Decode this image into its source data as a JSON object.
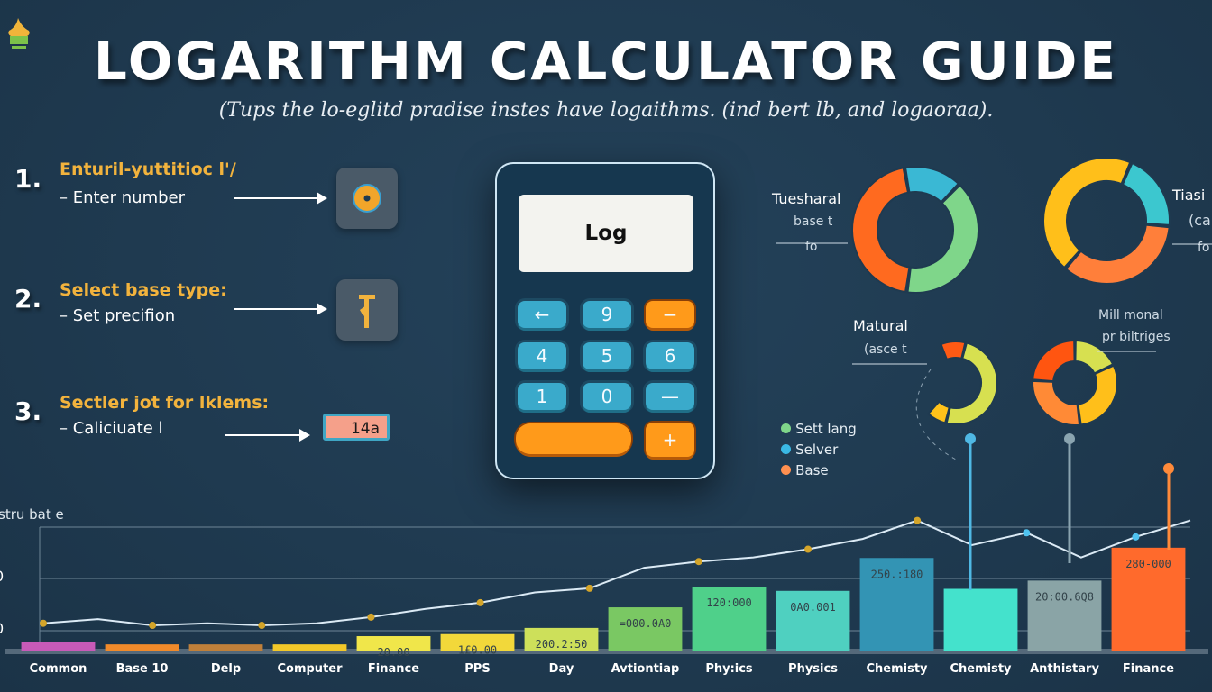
{
  "header": {
    "logo_icon": "calculator-hat-icon",
    "title": "LOGARITHM CALCULATOR GUIDE",
    "subtitle": "(Tups the lo-eglitd pradise instes have logaithms. (ind bert lb, and logaoraa)."
  },
  "steps": [
    {
      "number": "1.",
      "heading": "Enturil-yuttitioc l'/",
      "detail": "– Enter number",
      "icon": "input-dial-icon"
    },
    {
      "number": "2.",
      "heading": "Select base type:",
      "detail": "– Set precifion",
      "icon": "base-select-icon"
    },
    {
      "number": "3.",
      "heading": "Sectler jot for lklems:",
      "detail": "– Caliciuate l",
      "result_value": "14a"
    }
  ],
  "calculator": {
    "display": "Log",
    "keys": [
      {
        "label": "←",
        "color": "blue",
        "icon": "backspace-arrow-icon"
      },
      {
        "label": "9",
        "color": "blue"
      },
      {
        "label": "−",
        "color": "orange"
      },
      {
        "label": "4",
        "color": "blue"
      },
      {
        "label": "5",
        "color": "blue"
      },
      {
        "label": "6",
        "color": "blue"
      },
      {
        "label": "1",
        "color": "blue"
      },
      {
        "label": "0",
        "color": "blue"
      },
      {
        "label": "—",
        "color": "blue"
      },
      {
        "label": "",
        "color": "orange",
        "wide": true
      },
      {
        "label": "+",
        "color": "orange"
      }
    ]
  },
  "donuts": [
    {
      "label": "Tuesharal",
      "sublabel": "base t",
      "note": "fo",
      "segments": [
        {
          "name": "blue",
          "value": 15,
          "color": "#3ab8d4"
        },
        {
          "name": "green",
          "value": 40,
          "color": "#7fd68a"
        },
        {
          "name": "orange",
          "value": 45,
          "color": "#ff6a1f"
        }
      ]
    },
    {
      "label": "Tiasi",
      "sublabel": "(cal",
      "note": "fo",
      "segments": [
        {
          "name": "orange",
          "value": 35,
          "color": "#ff7f3a"
        },
        {
          "name": "yellow",
          "value": 45,
          "color": "#ffbf1a"
        },
        {
          "name": "teal",
          "value": 20,
          "color": "#3cc7cf"
        }
      ]
    },
    {
      "label": "Matural",
      "sublabel": "(asce t",
      "segments": [
        {
          "name": "red",
          "value": 10,
          "color": "#ff5a14"
        },
        {
          "name": "lime",
          "value": 50,
          "color": "#d7e050"
        },
        {
          "name": "amber",
          "value": 8,
          "color": "#ffc21a"
        }
      ]
    },
    {
      "label": "Mill monal",
      "sublabel": "pr biltriges",
      "segments": [
        {
          "name": "lime",
          "value": 18,
          "color": "#d7e050"
        },
        {
          "name": "amber",
          "value": 30,
          "color": "#ffbf1a"
        },
        {
          "name": "orange",
          "value": 28,
          "color": "#ff8a36"
        },
        {
          "name": "red",
          "value": 24,
          "color": "#ff5510"
        }
      ]
    }
  ],
  "legend": [
    {
      "label": "Sett lang",
      "color": "#7fd68a"
    },
    {
      "label": "Selver",
      "color": "#3ab8e4"
    },
    {
      "label": "Base",
      "color": "#ff9050"
    }
  ],
  "chart_data": {
    "type": "bar",
    "title": "",
    "ylabel": "stru bat e",
    "xlabel": "",
    "yticks": [
      "0",
      "0"
    ],
    "grid": true,
    "categories": [
      "Common",
      "Base 10",
      "Delp",
      "Computer",
      "Finance",
      "PPS",
      "Day",
      "Avtiontiap",
      "Phy:ics",
      "Physics",
      "Chemisty",
      "Chemisty",
      "Anthistary",
      "Finance"
    ],
    "values": [
      4,
      3,
      3,
      3,
      7,
      8,
      11,
      21,
      31,
      29,
      45,
      30,
      34,
      50
    ],
    "value_labels": [
      "",
      "",
      "",
      "",
      "20.00",
      "1£0.00",
      "200.2:50",
      "=000.0A0",
      "120:000",
      "0A0.001",
      "250.:180",
      "",
      "20:00.6Q8",
      "280-000"
    ],
    "bar_colors": [
      "#c75ab8",
      "#f08a2a",
      "#c0803a",
      "#f2c829",
      "#f0e64a",
      "#f2d83a",
      "#cde05a",
      "#7ac863",
      "#4fd08a",
      "#4fd0c0",
      "#3394b4",
      "#44e2cc",
      "#8aa4a6",
      "#ff6a2c"
    ],
    "line_values": [
      8,
      10,
      7,
      8,
      7,
      8,
      11,
      15,
      18,
      23,
      25,
      35,
      38,
      40,
      44,
      49,
      58,
      46,
      52,
      40,
      50,
      58
    ],
    "ylim": [
      0,
      60
    ]
  }
}
